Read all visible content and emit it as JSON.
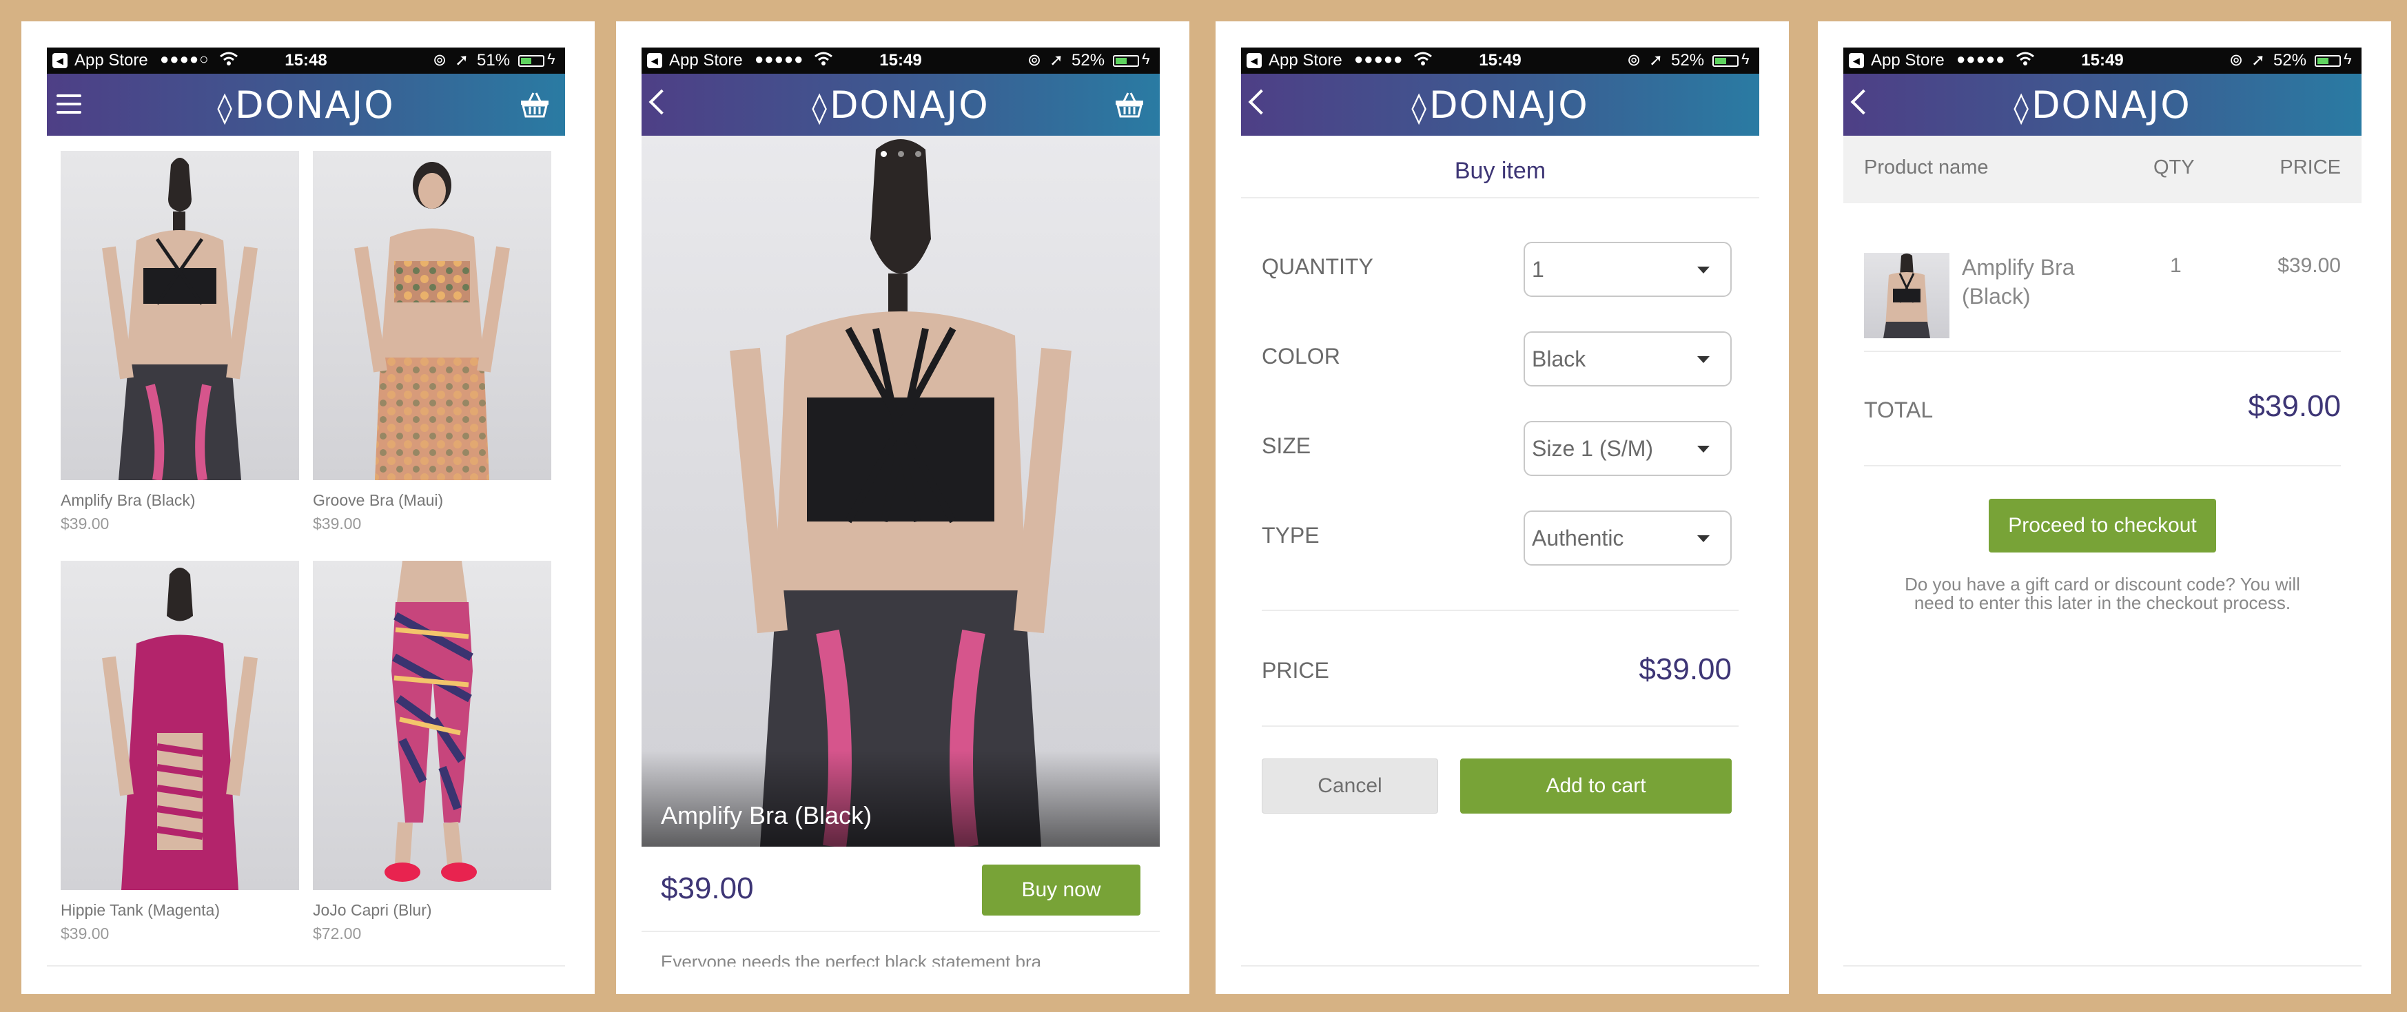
{
  "status_bars": [
    {
      "carrier": "App Store",
      "dots": "●●●●○",
      "time": "15:48",
      "battery": "51%",
      "level": 0.51
    },
    {
      "carrier": "App Store",
      "dots": "●●●●●",
      "time": "15:49",
      "battery": "52%",
      "level": 0.52
    },
    {
      "carrier": "App Store",
      "dots": "●●●●●",
      "time": "15:49",
      "battery": "52%",
      "level": 0.52
    },
    {
      "carrier": "App Store",
      "dots": "●●●●●",
      "time": "15:49",
      "battery": "52%",
      "level": 0.52
    }
  ],
  "brand": "DONAJO",
  "colors": {
    "accent": "#3d3575",
    "green": "#78a337",
    "nav_start": "#4e3f86",
    "nav_end": "#2a7ba3",
    "background": "#d6b284"
  },
  "catalog": {
    "products": [
      {
        "name": "Amplify Bra (Black)",
        "price": "$39.00"
      },
      {
        "name": "Groove Bra (Maui)",
        "price": "$39.00"
      },
      {
        "name": "Hippie Tank (Magenta)",
        "price": "$39.00"
      },
      {
        "name": "JoJo Capri (Blur)",
        "price": "$72.00"
      }
    ]
  },
  "product": {
    "caption": "Amplify Bra (Black)",
    "price": "$39.00",
    "buy_label": "Buy now",
    "description": "Everyone needs the perfect black statement bra"
  },
  "buy": {
    "title": "Buy item",
    "fields": [
      {
        "label": "QUANTITY",
        "value": "1"
      },
      {
        "label": "COLOR",
        "value": "Black"
      },
      {
        "label": "SIZE",
        "value": "Size 1 (S/M)"
      },
      {
        "label": "TYPE",
        "value": "Authentic"
      }
    ],
    "price_label": "PRICE",
    "price": "$39.00",
    "cancel": "Cancel",
    "add": "Add to cart"
  },
  "cart": {
    "headers": {
      "name": "Product name",
      "qty": "QTY",
      "price": "PRICE"
    },
    "item": {
      "name_line1": "Amplify Bra",
      "name_line2": "(Black)",
      "qty": "1",
      "price": "$39.00"
    },
    "total_label": "TOTAL",
    "total": "$39.00",
    "checkout": "Proceed to checkout",
    "note_line1": "Do you have a gift card or discount code? You will",
    "note_line2": "need to enter this later in the checkout process."
  }
}
